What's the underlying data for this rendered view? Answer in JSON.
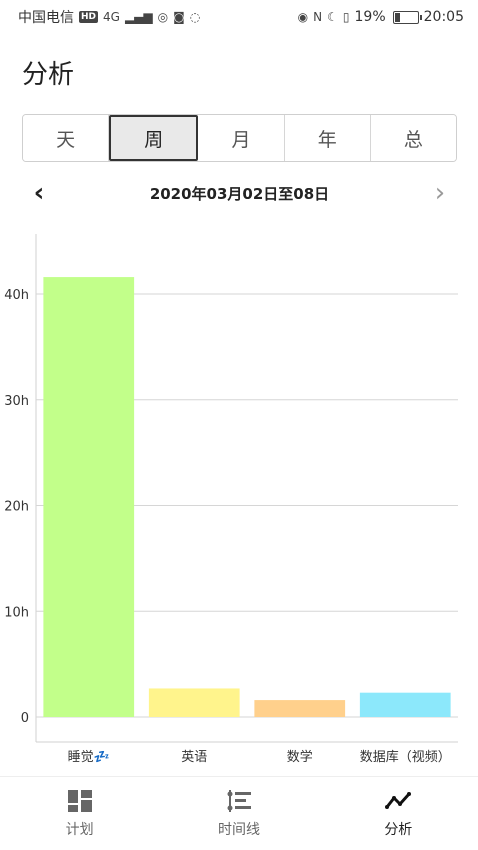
{
  "status_bar": {
    "carrier": "中国电信",
    "network": "4G",
    "hd": "HD",
    "battery": "19%",
    "time": "20:05"
  },
  "page": {
    "title": "分析"
  },
  "tabs": [
    {
      "label": "天",
      "active": false
    },
    {
      "label": "周",
      "active": true
    },
    {
      "label": "月",
      "active": false
    },
    {
      "label": "年",
      "active": false
    },
    {
      "label": "总",
      "active": false
    }
  ],
  "date_nav": {
    "prev_icon": "chevron-left-icon",
    "next_icon": "chevron-right-icon",
    "label": "2020年03月02日至08日"
  },
  "chart_data": {
    "type": "bar",
    "categories": [
      "睡觉💤",
      "英语",
      "数学",
      "数据库（视频）"
    ],
    "values": [
      41.6,
      2.7,
      1.6,
      2.3
    ],
    "colors": [
      "#c2ff8a",
      "#fff48c",
      "#ffd08c",
      "#8ce8fb"
    ],
    "ylim": [
      0,
      46
    ],
    "yticks": [
      0,
      10,
      20,
      30,
      40
    ],
    "ytick_labels": [
      "0",
      "10h",
      "20h",
      "30h",
      "40h"
    ],
    "grid": true
  },
  "bottom_nav": [
    {
      "label": "计划",
      "icon": "dashboard-icon",
      "active": false
    },
    {
      "label": "时间线",
      "icon": "timeline-icon",
      "active": false
    },
    {
      "label": "分析",
      "icon": "analytics-icon",
      "active": true
    }
  ]
}
